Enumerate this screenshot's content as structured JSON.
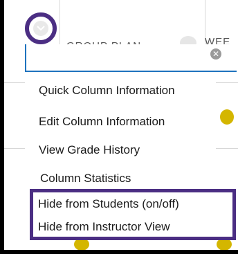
{
  "grid": {
    "column_header": "GROUP PLAN",
    "next_column_header": "WEE"
  },
  "search": {
    "value": "",
    "clear_icon": "✕"
  },
  "icons": {
    "chevron": "chevron-down-icon",
    "clear": "clear-icon",
    "grade_status": "needs-grading-icon"
  },
  "menu": {
    "items": [
      {
        "label": "Quick Column Information"
      },
      {
        "label": "Edit Column Information"
      },
      {
        "label": "View Grade History"
      },
      {
        "label": "Column Statistics"
      },
      {
        "label": "Hide from Students (on/off)"
      },
      {
        "label": "Hide from Instructor View"
      }
    ]
  },
  "colors": {
    "highlight": "#4b2e83",
    "input_border": "#1e73be",
    "status_dot": "#d4b600"
  }
}
